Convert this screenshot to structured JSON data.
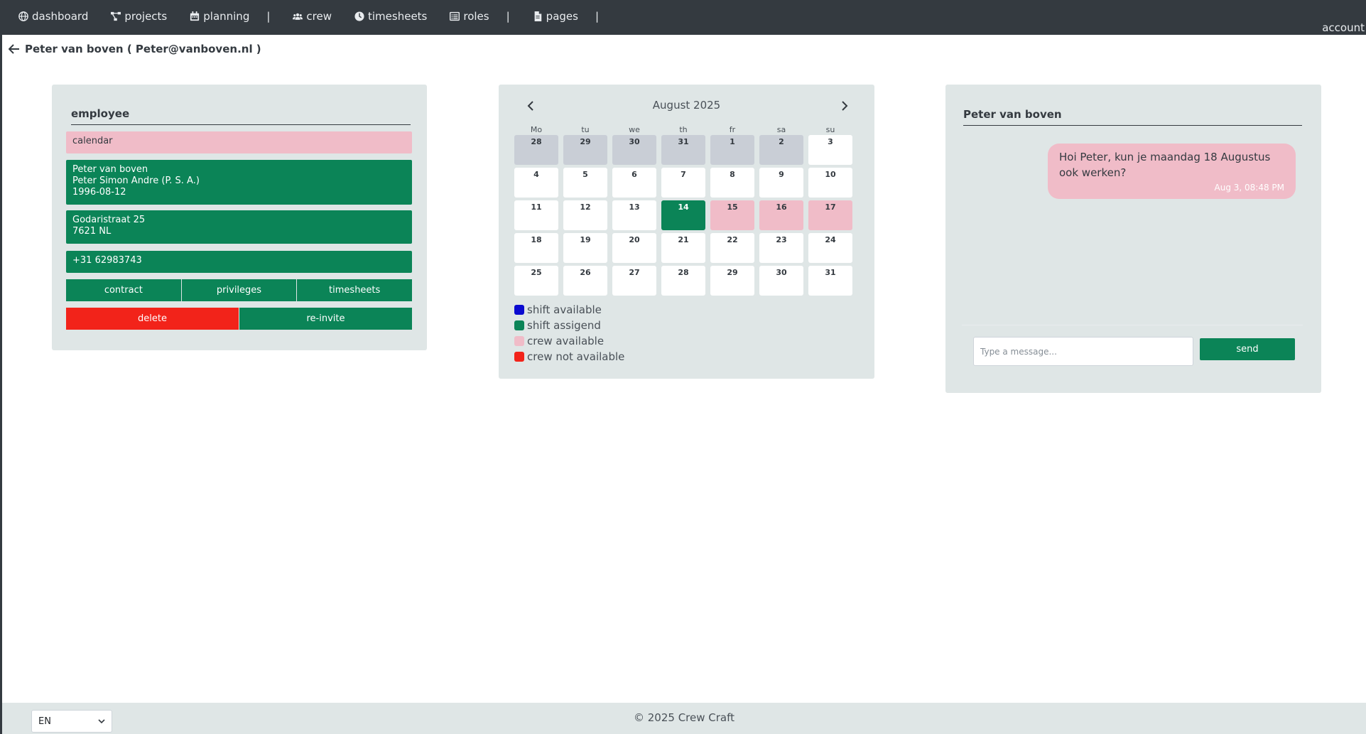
{
  "nav": {
    "items": [
      {
        "label": "dashboard",
        "icon": "globe-icon"
      },
      {
        "label": "projects",
        "icon": "project-diagram-icon"
      },
      {
        "label": "planning",
        "icon": "calendar-icon"
      },
      {
        "label": "crew",
        "icon": "users-icon"
      },
      {
        "label": "timesheets",
        "icon": "clock-icon"
      },
      {
        "label": "roles",
        "icon": "list-icon"
      },
      {
        "label": "pages",
        "icon": "file-icon"
      }
    ],
    "separator": "|",
    "account": "account"
  },
  "header": {
    "title": "Peter van boven ( Peter@vanboven.nl )"
  },
  "employee": {
    "title": "employee",
    "calendar_label": "calendar",
    "name": "Peter van boven",
    "full_name": "Peter Simon Andre (P. S. A.)",
    "birthdate": "1996-08-12",
    "street": "Godaristraat 25",
    "postal": "7621 NL",
    "phone": "+31 62983743",
    "buttons": {
      "contract": "contract",
      "privileges": "privileges",
      "timesheets": "timesheets",
      "delete": "delete",
      "reinvite": "re-invite"
    }
  },
  "calendar": {
    "month": "August 2025",
    "weekdays": [
      "Mo",
      "tu",
      "we",
      "th",
      "fr",
      "sa",
      "su"
    ],
    "weeks": [
      [
        {
          "d": "28",
          "s": "other"
        },
        {
          "d": "29",
          "s": "other"
        },
        {
          "d": "30",
          "s": "other"
        },
        {
          "d": "31",
          "s": "other"
        },
        {
          "d": "1",
          "s": "other"
        },
        {
          "d": "2",
          "s": "other"
        },
        {
          "d": "3",
          "s": ""
        }
      ],
      [
        {
          "d": "4",
          "s": ""
        },
        {
          "d": "5",
          "s": ""
        },
        {
          "d": "6",
          "s": ""
        },
        {
          "d": "7",
          "s": ""
        },
        {
          "d": "8",
          "s": ""
        },
        {
          "d": "9",
          "s": ""
        },
        {
          "d": "10",
          "s": ""
        }
      ],
      [
        {
          "d": "11",
          "s": ""
        },
        {
          "d": "12",
          "s": ""
        },
        {
          "d": "13",
          "s": ""
        },
        {
          "d": "14",
          "s": "assigned"
        },
        {
          "d": "15",
          "s": "available"
        },
        {
          "d": "16",
          "s": "available"
        },
        {
          "d": "17",
          "s": "available"
        }
      ],
      [
        {
          "d": "18",
          "s": ""
        },
        {
          "d": "19",
          "s": ""
        },
        {
          "d": "20",
          "s": ""
        },
        {
          "d": "21",
          "s": ""
        },
        {
          "d": "22",
          "s": ""
        },
        {
          "d": "23",
          "s": ""
        },
        {
          "d": "24",
          "s": ""
        }
      ],
      [
        {
          "d": "25",
          "s": ""
        },
        {
          "d": "26",
          "s": ""
        },
        {
          "d": "27",
          "s": ""
        },
        {
          "d": "28",
          "s": ""
        },
        {
          "d": "29",
          "s": ""
        },
        {
          "d": "30",
          "s": ""
        },
        {
          "d": "31",
          "s": ""
        }
      ]
    ],
    "legend": [
      {
        "label": "shift available",
        "color": "#0a0ad0"
      },
      {
        "label": "shift assigend",
        "color": "#0b8457"
      },
      {
        "label": "crew available",
        "color": "#f0bcc8"
      },
      {
        "label": "crew not available",
        "color": "#f2231a"
      }
    ]
  },
  "chat": {
    "title": "Peter van boven",
    "message": "Hoi Peter, kun je maandag 18 Augustus ook werken?",
    "message_time": "Aug 3, 08:48 PM",
    "input_placeholder": "Type a message...",
    "send_label": "send"
  },
  "footer": {
    "language": "EN",
    "copyright": "© 2025 Crew Craft"
  },
  "colors": {
    "nav_bg": "#343a40",
    "panel_bg": "#dfe6e6",
    "green": "#0b8457",
    "pink": "#f0bcc8",
    "red": "#f2231a"
  }
}
